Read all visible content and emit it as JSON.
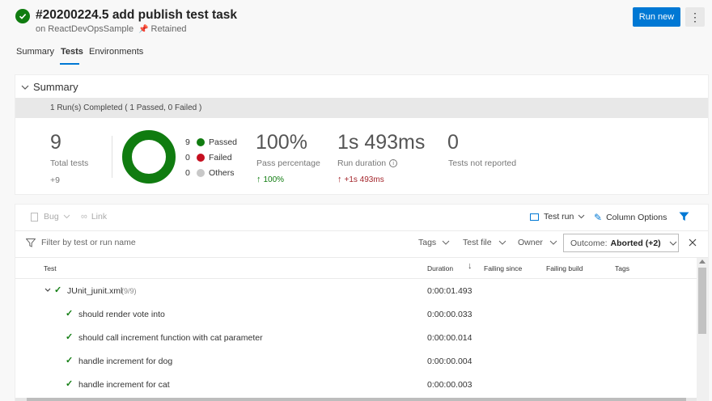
{
  "header": {
    "title": "#20200224.5 add publish test task",
    "project": "on ReactDevOpsSample",
    "retained": "Retained",
    "run_new": "Run new"
  },
  "tabs": [
    {
      "label": "Summary",
      "active": false
    },
    {
      "label": "Tests",
      "active": true
    },
    {
      "label": "Environments",
      "active": false
    }
  ],
  "summary": {
    "title": "Summary",
    "banner": "1 Run(s) Completed ( 1 Passed, 0 Failed )",
    "total_tests": "9",
    "total_label": "Total tests",
    "total_delta": "+9",
    "legend": [
      {
        "count": "9",
        "label": "Passed",
        "color": "#107c10"
      },
      {
        "count": "0",
        "label": "Failed",
        "color": "#c50f1f"
      },
      {
        "count": "0",
        "label": "Others",
        "color": "#c8c8c8"
      }
    ],
    "pass_pct": "100%",
    "pass_label": "Pass percentage",
    "pass_delta": "100%",
    "duration": "1s 493ms",
    "duration_label": "Run duration",
    "duration_delta": "+1s 493ms",
    "not_reported": "0",
    "not_reported_label": "Tests not reported",
    "colors": {
      "passed": "#107c10",
      "delta_up_good": "#107c10",
      "delta_up_bad": "#a4262c"
    }
  },
  "toolbar": {
    "bug": "Bug",
    "link": "Link",
    "test_run": "Test run",
    "column_options": "Column Options"
  },
  "filters": {
    "placeholder": "Filter by test or run name",
    "tags": "Tags",
    "test_file": "Test file",
    "owner": "Owner",
    "outcome_prefix": "Outcome:",
    "outcome_value": "Aborted (+2)"
  },
  "table": {
    "headers": {
      "test": "Test",
      "duration": "Duration",
      "failing_since": "Failing since",
      "failing_build": "Failing build",
      "tags": "Tags"
    },
    "group": {
      "name": "JUnit_junit.xml",
      "count": "(9/9)",
      "duration": "0:00:01.493"
    },
    "rows": [
      {
        "name": "should render vote into",
        "duration": "0:00:00.033"
      },
      {
        "name": "should call increment function with cat parameter",
        "duration": "0:00:00.014"
      },
      {
        "name": "handle increment for dog",
        "duration": "0:00:00.004"
      },
      {
        "name": "handle increment for cat",
        "duration": "0:00:00.003"
      }
    ]
  }
}
